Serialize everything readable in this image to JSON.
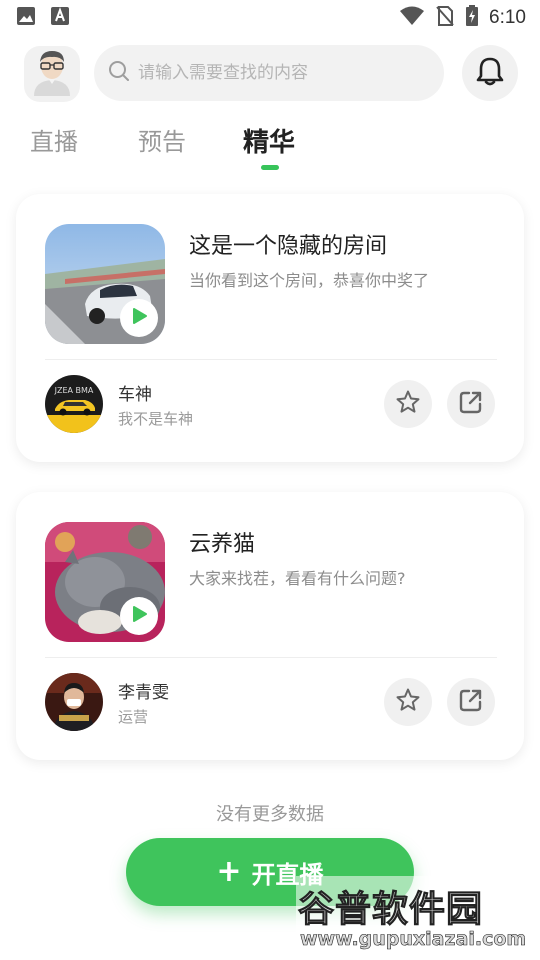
{
  "status_bar": {
    "time": "6:10",
    "icons": [
      "image-icon",
      "text-a-icon",
      "wifi-icon",
      "no-sim-icon",
      "battery-charging-icon"
    ]
  },
  "header": {
    "avatar_icon": "user-avatar-icon",
    "search_placeholder": "请输入需要查找的内容",
    "search_value": "",
    "bell_icon": "bell-icon"
  },
  "tabs": [
    {
      "label": "直播",
      "active": false
    },
    {
      "label": "预告",
      "active": false
    },
    {
      "label": "精华",
      "active": true
    }
  ],
  "accent_color": "#3fc45c",
  "rooms": [
    {
      "title": "这是一个隐藏的房间",
      "description": "当你看到这个房间，恭喜你中奖了",
      "host_name": "车神",
      "host_role": "我不是车神"
    },
    {
      "title": "云养猫",
      "description": "大家来找茬，看看有什么问题?",
      "host_name": "李青雯",
      "host_role": "运营"
    }
  ],
  "no_more_text": "没有更多数据",
  "live_button": {
    "label": "开直播"
  },
  "watermark": {
    "text": "谷普软件园",
    "url": "www.gupuxiazai.com"
  }
}
